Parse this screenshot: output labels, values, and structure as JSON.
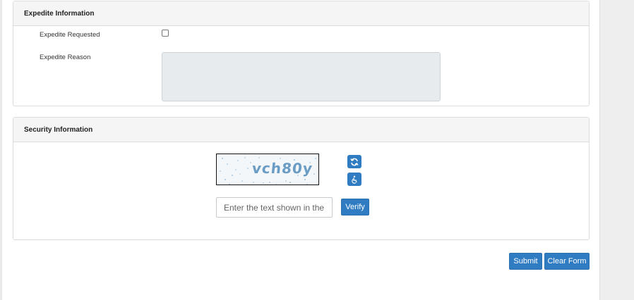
{
  "expedite_section": {
    "title": "Expedite Information",
    "requested_label": "Expedite Requested",
    "requested_checked": false,
    "reason_label": "Expedite Reason",
    "reason_value": ""
  },
  "security_section": {
    "title": "Security Information",
    "captcha_text": "vch80y",
    "refresh_icon": "refresh-icon",
    "audio_icon": "accessibility-audio-icon",
    "input_placeholder": "Enter the text shown in the",
    "input_value": "",
    "verify_label": "Verify"
  },
  "actions": {
    "submit_label": "Submit",
    "clear_label": "Clear Form"
  },
  "colors": {
    "primary": "#2f7cc2",
    "panel_header_bg": "#f5f5f5",
    "textarea_bg": "#e8ebee",
    "captcha_text": "#6a9cc4"
  }
}
